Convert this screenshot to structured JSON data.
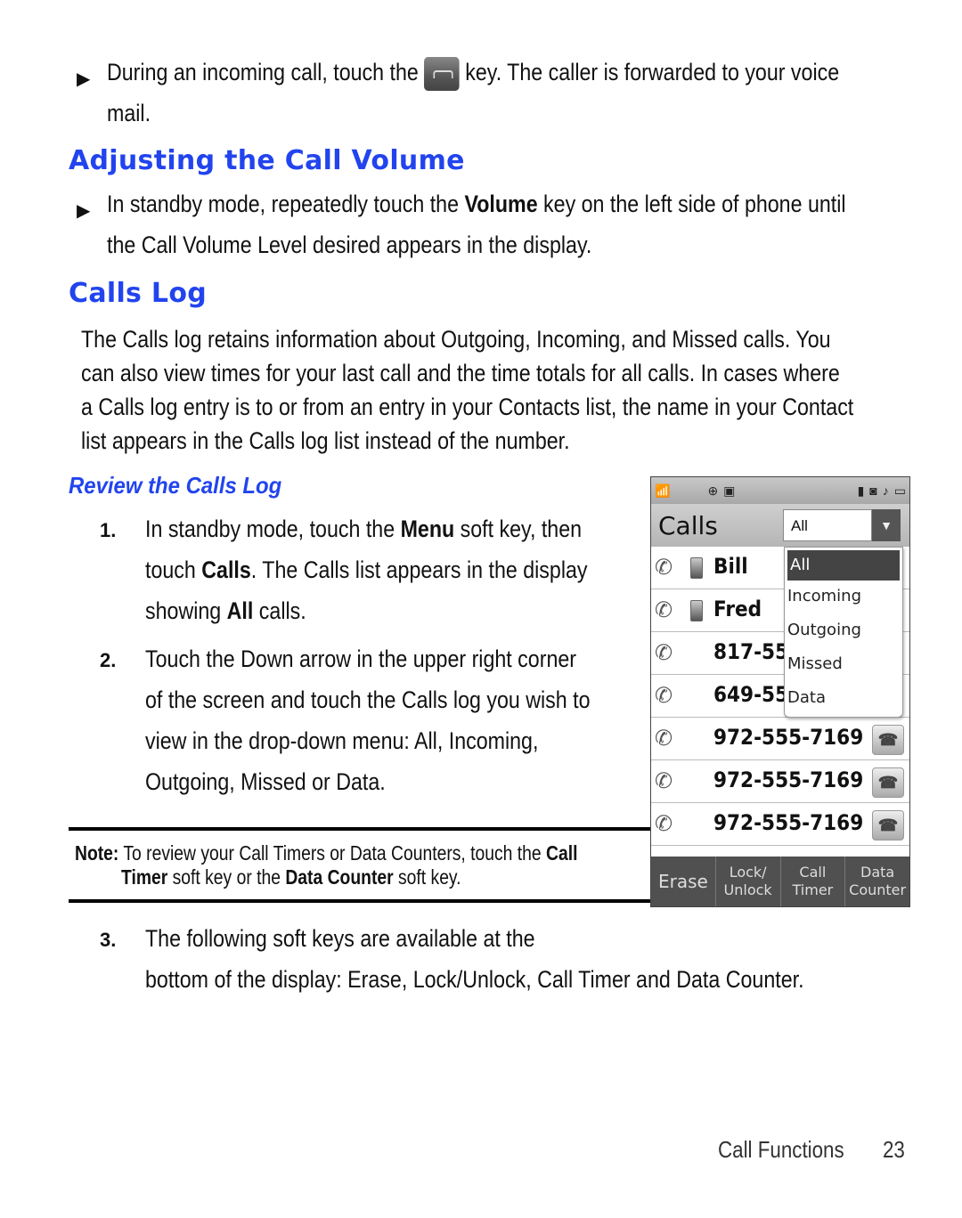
{
  "intro_bullet": {
    "before": "During an incoming call, touch the",
    "after": "key. The caller is forwarded to your voice",
    "line2": "mail.",
    "key_icon": "end-call-key-icon"
  },
  "section_volume": {
    "heading": "Adjusting the Call Volume",
    "bullet_line1_a": "In standby mode, repeatedly touch the ",
    "bullet_line1_bold": "Volume",
    "bullet_line1_b": " key on the left side of phone until",
    "bullet_line2": "the Call Volume Level desired appears in the display."
  },
  "section_calls_log": {
    "heading": "Calls Log",
    "paragraph": [
      "The Calls log retains information about Outgoing, Incoming, and Missed calls. You",
      "can also view times for your last call and the time totals for all calls. In cases where",
      "a Calls log entry is to or from an entry in your Contacts list, the name in your Contact",
      "list appears in the Calls log list instead of the number."
    ]
  },
  "review": {
    "heading": "Review the Calls Log",
    "step1": {
      "num": "1.",
      "l1_a": "In standby mode, touch the ",
      "l1_bold": "Menu",
      "l1_b": " soft key, then",
      "l2_a": "touch ",
      "l2_bold": "Calls",
      "l2_b": ". The Calls list appears in the display",
      "l3_a": "showing ",
      "l3_bold": "All",
      "l3_b": " calls."
    },
    "step2": {
      "num": "2.",
      "lines": [
        "Touch the Down arrow in the upper right corner",
        "of the screen and touch the Calls log you wish to",
        "view in the drop-down menu: All, Incoming,",
        "Outgoing, Missed or Data."
      ]
    },
    "note": {
      "label": "Note:",
      "l1": " To review your Call Timers or Data Counters, touch the ",
      "l1_bold": "Call",
      "l2_bold1": "Timer",
      "l2_mid": " soft key or the ",
      "l2_bold2": "Data Counter",
      "l2_end": " soft key."
    },
    "step3": {
      "num": "3.",
      "l1": "The following soft keys are available at the",
      "l2": "bottom of the display: Erase, Lock/Unlock, Call Timer and Data Counter."
    }
  },
  "phone": {
    "title": "Calls",
    "filter_value": "All",
    "dropdown_options": [
      "All",
      "Incoming",
      "Outgoing",
      "Missed",
      "Data"
    ],
    "selected_option": "All",
    "rows": [
      {
        "name": "Bill",
        "mobile": true,
        "call_button": false
      },
      {
        "name": "Fred",
        "mobile": true,
        "call_button": false
      },
      {
        "name": "817-55",
        "mobile": false,
        "call_button": false
      },
      {
        "name": "649-55",
        "mobile": false,
        "call_button": false
      },
      {
        "name": "972-555-7169",
        "mobile": false,
        "call_button": true
      },
      {
        "name": "972-555-7169",
        "mobile": false,
        "call_button": true
      },
      {
        "name": "972-555-7169",
        "mobile": false,
        "call_button": true
      }
    ],
    "softkeys": [
      {
        "line1": "Erase",
        "line2": ""
      },
      {
        "line1": "Lock/",
        "line2": "Unlock"
      },
      {
        "line1": "Call",
        "line2": "Timer"
      },
      {
        "line1": "Data",
        "line2": "Counter"
      }
    ]
  },
  "footer": {
    "section": "Call Functions",
    "page": "23"
  }
}
